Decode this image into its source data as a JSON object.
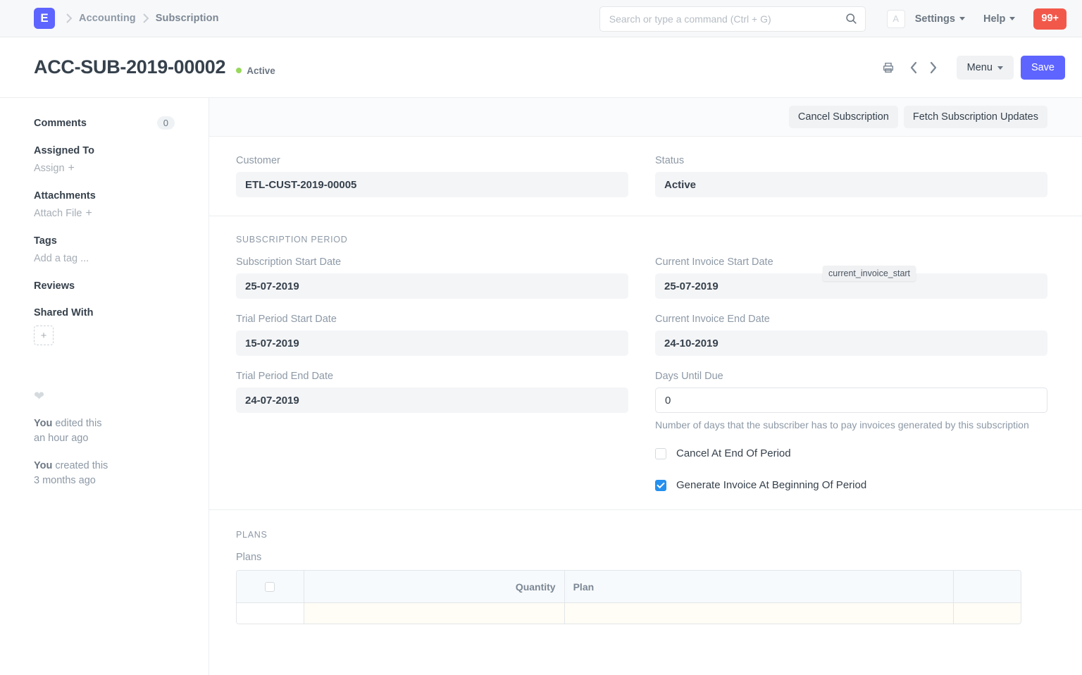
{
  "navbar": {
    "logo_letter": "E",
    "breadcrumb": [
      "Accounting",
      "Subscription"
    ],
    "search_placeholder": "Search or type a command (Ctrl + G)",
    "avatar_letter": "A",
    "settings_label": "Settings",
    "help_label": "Help",
    "notifications_count": "99+",
    "brand_color": "#5e64ff",
    "notif_color": "#f2584a"
  },
  "page_head": {
    "title": "ACC-SUB-2019-00002",
    "status": "Active",
    "status_color": "#98d85b",
    "menu_label": "Menu",
    "save_label": "Save"
  },
  "sidebar": {
    "comments_label": "Comments",
    "comments_count": "0",
    "assigned_to_label": "Assigned To",
    "assign_label": "Assign",
    "attachments_label": "Attachments",
    "attach_file_label": "Attach File",
    "tags_label": "Tags",
    "add_tag_label": "Add a tag ...",
    "reviews_label": "Reviews",
    "shared_with_label": "Shared With",
    "activity": [
      {
        "who": "You",
        "what": " edited this",
        "when": "an hour ago"
      },
      {
        "who": "You",
        "what": " created this",
        "when": "3 months ago"
      }
    ]
  },
  "toolbar": {
    "cancel_subscription_label": "Cancel Subscription",
    "fetch_updates_label": "Fetch Subscription Updates"
  },
  "form": {
    "customer_label": "Customer",
    "customer_value": "ETL-CUST-2019-00005",
    "status_label": "Status",
    "status_value": "Active",
    "subscription_period_section": "SUBSCRIPTION PERIOD",
    "subscription_start_label": "Subscription Start Date",
    "subscription_start_value": "25-07-2019",
    "trial_start_label": "Trial Period Start Date",
    "trial_start_value": "15-07-2019",
    "trial_end_label": "Trial Period End Date",
    "trial_end_value": "24-07-2019",
    "current_invoice_start_label": "Current Invoice Start Date",
    "current_invoice_start_value": "25-07-2019",
    "current_invoice_end_label": "Current Invoice End Date",
    "current_invoice_end_value": "24-10-2019",
    "days_until_due_label": "Days Until Due",
    "days_until_due_value": "0",
    "days_until_due_desc": "Number of days that the subscriber has to pay invoices generated by this subscription",
    "tooltip_text": "current_invoice_start",
    "cancel_at_end_label": "Cancel At End Of Period",
    "cancel_at_end_checked": false,
    "generate_invoice_label": "Generate Invoice At Beginning Of Period",
    "generate_invoice_checked": true,
    "checkbox_accent": "#2490ef"
  },
  "plans": {
    "section_title": "PLANS",
    "field_label": "Plans",
    "columns": [
      "",
      "",
      "Quantity",
      "Plan",
      ""
    ]
  }
}
